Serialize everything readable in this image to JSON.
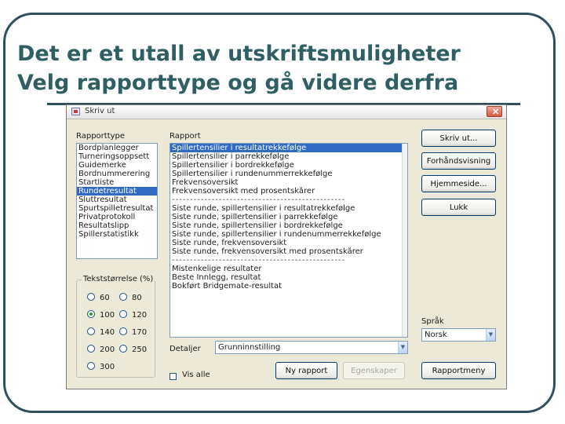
{
  "slide": {
    "title_line1": "Det er et utall av utskriftsmuligheter",
    "title_line2": "Velg rapporttype og gå videre derfra"
  },
  "dialog": {
    "title": "Skriv ut",
    "close_glyph": "✕",
    "rapporttype": {
      "label": "Rapporttype",
      "items": [
        {
          "label": "Bordplanlegger",
          "selected": false
        },
        {
          "label": "Turneringsoppsett",
          "selected": false
        },
        {
          "label": "Guidemerke",
          "selected": false
        },
        {
          "label": "Bordnummerering",
          "selected": false
        },
        {
          "label": "Startliste",
          "selected": false
        },
        {
          "label": "Rundetresultat",
          "selected": true
        },
        {
          "label": "Sluttresultat",
          "selected": false
        },
        {
          "label": "Spurtspilletresultat",
          "selected": false
        },
        {
          "label": "Privatprotokoll",
          "selected": false
        },
        {
          "label": "Resultatslipp",
          "selected": false
        },
        {
          "label": "Spillerstatistikk",
          "selected": false
        }
      ]
    },
    "rapport": {
      "label": "Rapport",
      "items": [
        {
          "label": "Spillertensilier i resultatrekkefølge",
          "selected": true
        },
        {
          "label": "Spillertensilier i parrekkefølge",
          "selected": false
        },
        {
          "label": "Spillertensilier i bordrekkefølge",
          "selected": false
        },
        {
          "label": "Spillertensilier i rundenummerrekkefølge",
          "selected": false
        },
        {
          "label": "Frekvensoversikt",
          "selected": false
        },
        {
          "label": "Frekvensoversikt med prosentskårer",
          "selected": false
        },
        {
          "label": "------------------------------------------------",
          "separator": true
        },
        {
          "label": "Siste runde, spillertensilier i resultatrekkefølge",
          "selected": false
        },
        {
          "label": "Siste runde, spillertensilier i parrekkefølge",
          "selected": false
        },
        {
          "label": "Siste runde, spillertensilier i bordrekkefølge",
          "selected": false
        },
        {
          "label": "Siste runde, spillertensilier i rundenummerrekkefølge",
          "selected": false
        },
        {
          "label": "Siste runde, frekvensoversikt",
          "selected": false
        },
        {
          "label": "Siste runde, frekvensoversikt med prosentskårer",
          "selected": false
        },
        {
          "label": "------------------------------------------------",
          "separator": true
        },
        {
          "label": "Mistenkelige resultater",
          "selected": false
        },
        {
          "label": "Beste Innlegg, resultat",
          "selected": false
        },
        {
          "label": "Bokført Bridgemate-resultat",
          "selected": false
        }
      ]
    },
    "tekststorrelse": {
      "label": "Tekststørrelse (%)",
      "options": [
        {
          "label": "60",
          "checked": false
        },
        {
          "label": "80",
          "checked": false
        },
        {
          "label": "100",
          "checked": true
        },
        {
          "label": "120",
          "checked": false
        },
        {
          "label": "140",
          "checked": false
        },
        {
          "label": "170",
          "checked": false
        },
        {
          "label": "200",
          "checked": false
        },
        {
          "label": "250",
          "checked": false
        },
        {
          "label": "300",
          "checked": false
        }
      ]
    },
    "vis_alle_label": "Vis alle",
    "detaljer": {
      "label": "Detaljer",
      "value": "Grunninnstilling"
    },
    "sprak": {
      "label": "Språk",
      "value": "Norsk"
    },
    "buttons": {
      "skriv_ut": "Skriv ut...",
      "forhandsvisning": "Forhåndsvisning",
      "hjemmeside": "Hjemmeside...",
      "lukk": "Lukk",
      "ny_rapport": "Ny rapport",
      "egenskaper": "Egenskaper",
      "rapportmeny": "Rapportmeny"
    },
    "combo_arrow_glyph": "▼"
  }
}
